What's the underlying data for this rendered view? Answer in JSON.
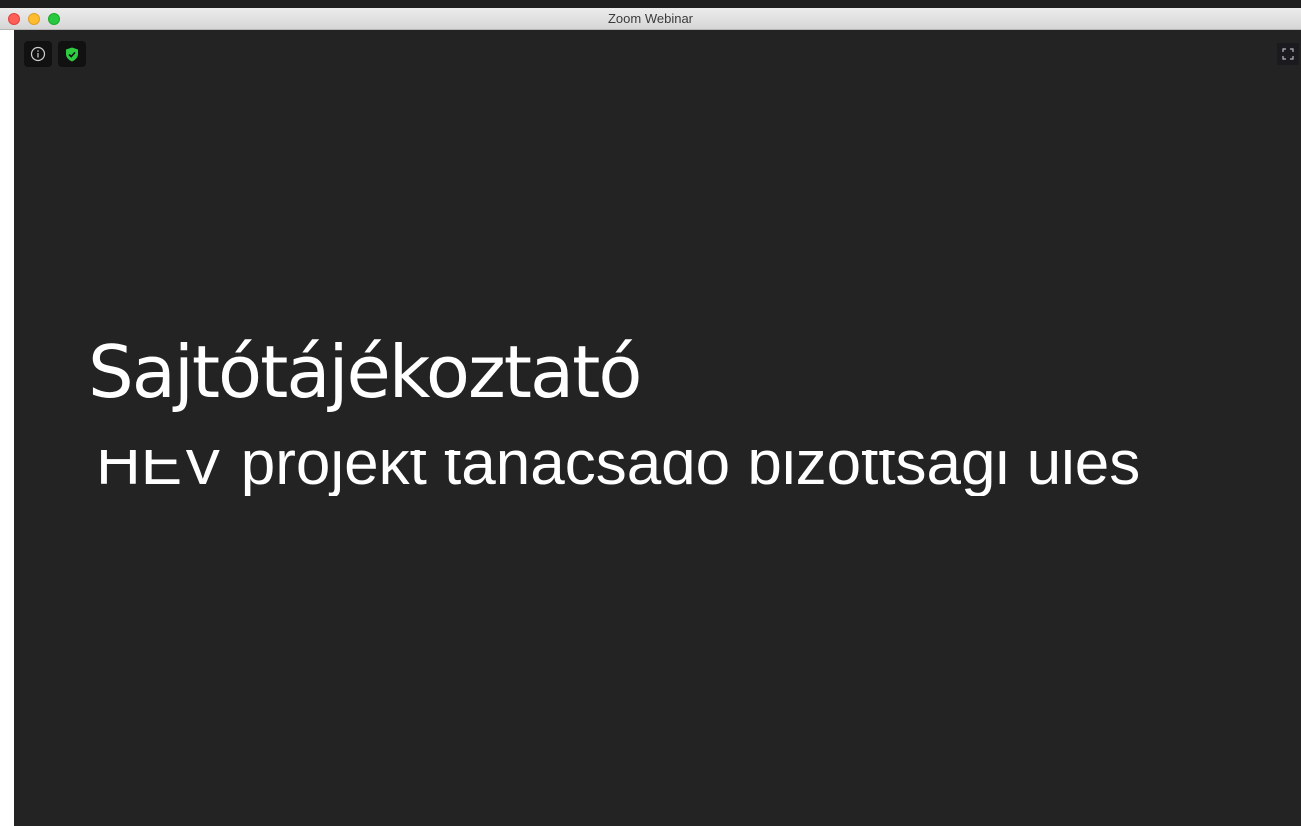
{
  "window": {
    "title": "Zoom Webinar"
  },
  "toolbar": {
    "info_icon": "info-icon",
    "security_icon": "shield-check-icon",
    "fullscreen_icon": "fullscreen-icon"
  },
  "slide": {
    "title": "Sajtótájékoztató",
    "subtitle": "HÉV projekt tanácsadó bizottsági ülés"
  },
  "colors": {
    "background": "#232323",
    "shield_green": "#2ecc40",
    "text": "#ffffff"
  }
}
